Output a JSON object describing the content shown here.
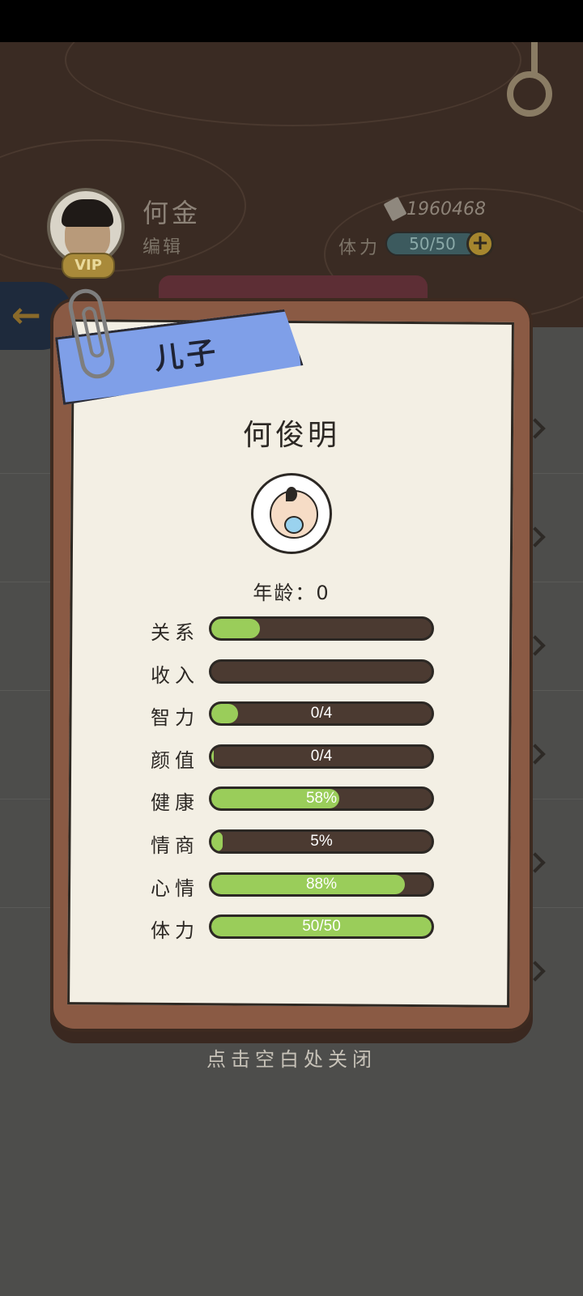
{
  "player": {
    "name": "何金",
    "job": "编辑",
    "vip": "VIP",
    "money": "1960468",
    "stamina_label": "体力",
    "stamina": "50/50"
  },
  "dialog": {
    "tag": "儿子",
    "child_name": "何俊明",
    "age_label": "年龄：",
    "age_value": "0",
    "stats": [
      {
        "label": "关系",
        "fill": 0.22,
        "text": ""
      },
      {
        "label": "收入",
        "fill": 0.0,
        "text": ""
      },
      {
        "label": "智力",
        "fill": 0.12,
        "text": "0/4"
      },
      {
        "label": "颜值",
        "fill": 0.01,
        "text": "0/4"
      },
      {
        "label": "健康",
        "fill": 0.58,
        "text": "58%"
      },
      {
        "label": "情商",
        "fill": 0.05,
        "text": "5%"
      },
      {
        "label": "心情",
        "fill": 0.88,
        "text": "88%"
      },
      {
        "label": "体力",
        "fill": 1.0,
        "text": "50/50"
      }
    ],
    "close_hint": "点击空白处关闭"
  },
  "colors": {
    "bar_fill": "#9acd5a",
    "bar_bg": "#4b3a31",
    "ribbon": "#7f9fe8",
    "board": "#8a5a44",
    "paper": "#f3efe4"
  }
}
